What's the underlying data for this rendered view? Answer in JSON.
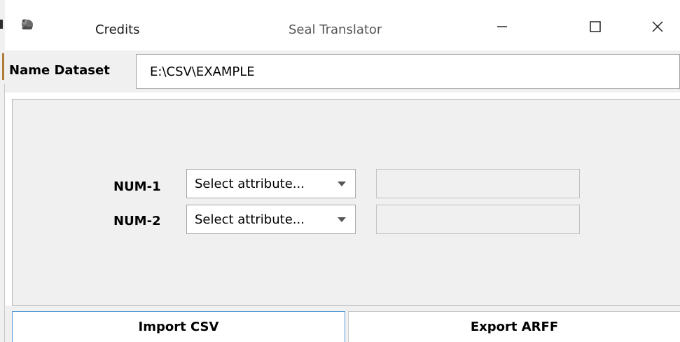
{
  "window": {
    "title": "Seal Translator",
    "credits_label": "Credits",
    "app_icon": "seal-icon",
    "controls": [
      "minimize-icon",
      "maximize-icon",
      "close-icon"
    ]
  },
  "dataset": {
    "label": "Name Dataset",
    "value": "E:\\CSV\\EXAMPLE"
  },
  "attributes": [
    {
      "label": "NUM-1",
      "select_value": "Select attribute...",
      "field_value": ""
    },
    {
      "label": "NUM-2",
      "select_value": "Select attribute...",
      "field_value": ""
    }
  ],
  "buttons": {
    "import_label": "Import CSV",
    "export_label": "Export ARFF"
  },
  "colors": {
    "background": "#f0f0f0",
    "focus_border": "#5a9ad8"
  }
}
